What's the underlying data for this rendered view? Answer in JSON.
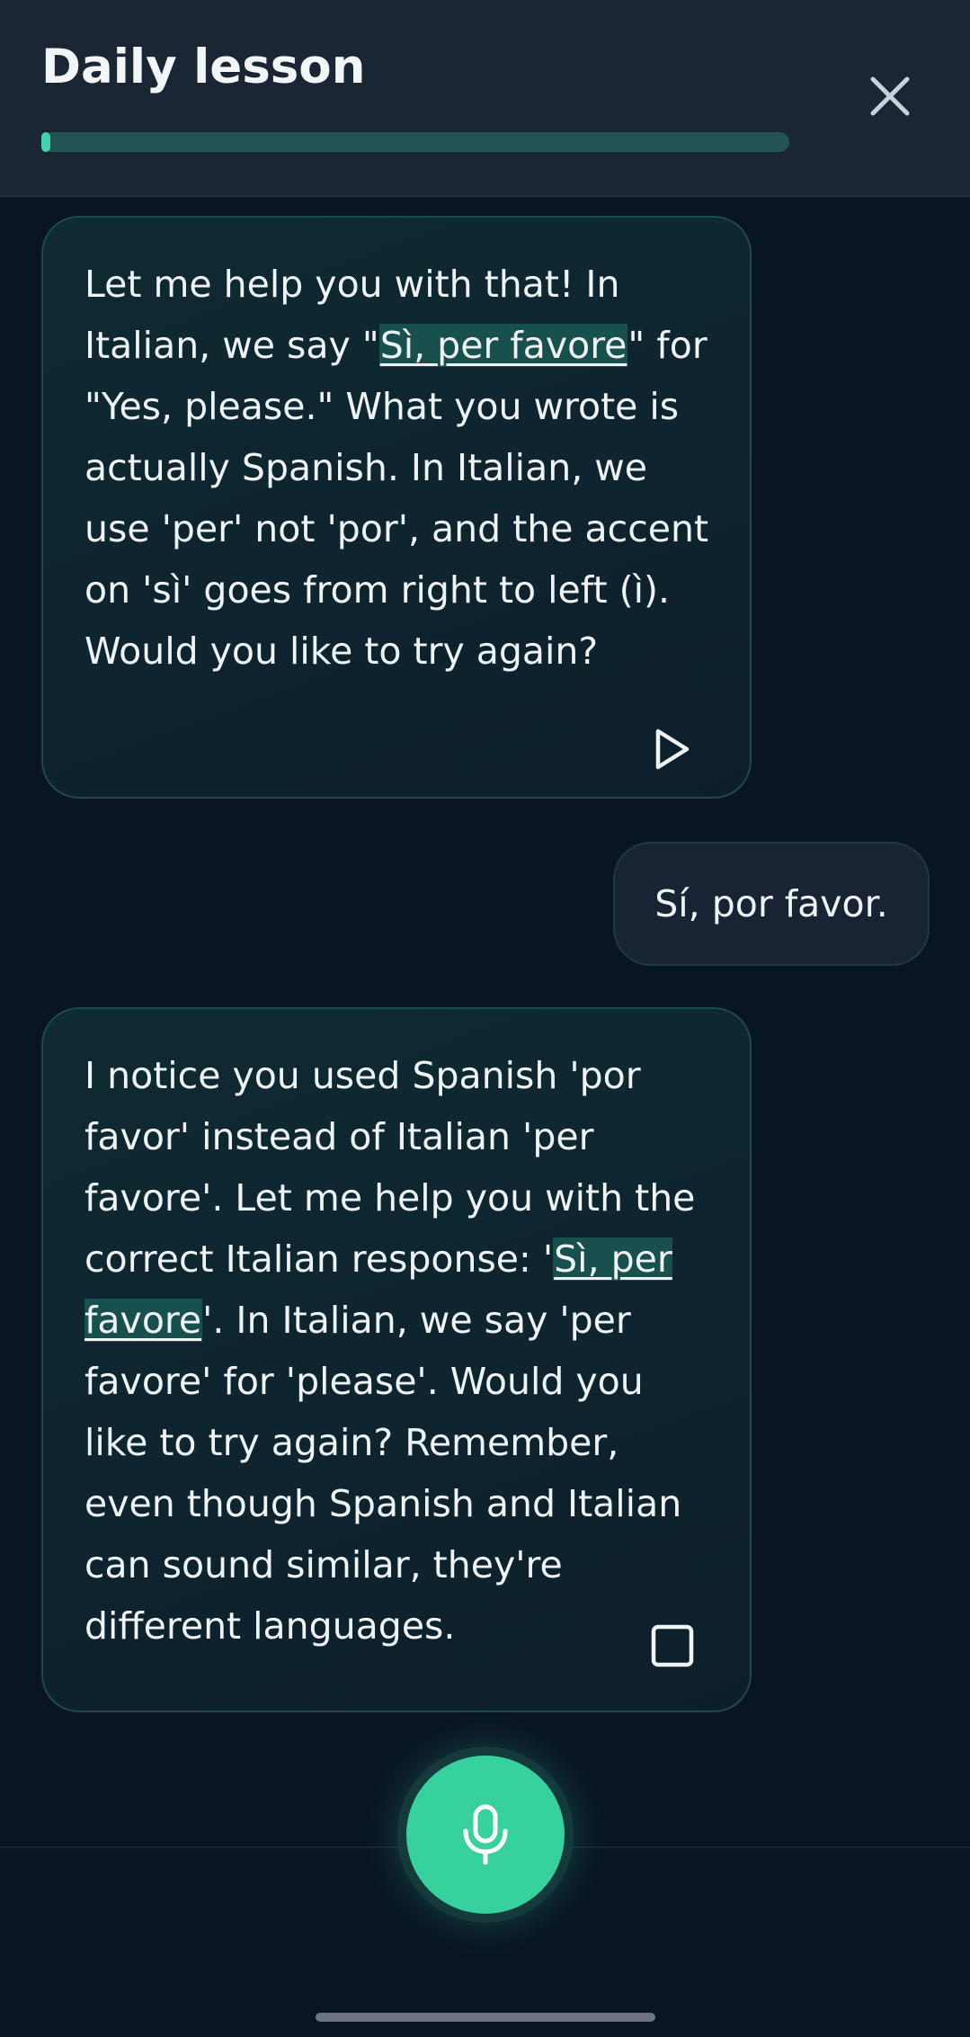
{
  "header": {
    "title": "Daily lesson",
    "close_icon": "close-icon",
    "progress": 0.01
  },
  "messages": [
    {
      "role": "assistant",
      "parts": [
        "Let me help you with that! In Italian, we say \"",
        "Sì, per favore",
        "\" for \"Yes, please.\" What you wrote is actually Spanish. In Italian, we use 'per' not 'por', and the accent on 'sì' goes from right to left (ì). Would you like to try again?"
      ],
      "action_icon": "play-icon"
    },
    {
      "role": "user",
      "text": "Sí, por favor."
    },
    {
      "role": "assistant",
      "parts": [
        "I notice you used Spanish 'por favor' instead of Italian 'per favore'. Let me help you with the correct Italian response: '",
        "Sì, per favore",
        "'. In Italian, we say 'per favore' for 'please'. Would you like to try again? Remember, even though Spanish and Italian can sound similar, they're different languages."
      ],
      "action_icon": "stop-icon"
    }
  ],
  "composer": {
    "mic_icon": "microphone-icon"
  },
  "colors": {
    "accent": "#36d19c",
    "background": "#0a1523",
    "header": "#1b2635",
    "highlight": "#17504c"
  }
}
